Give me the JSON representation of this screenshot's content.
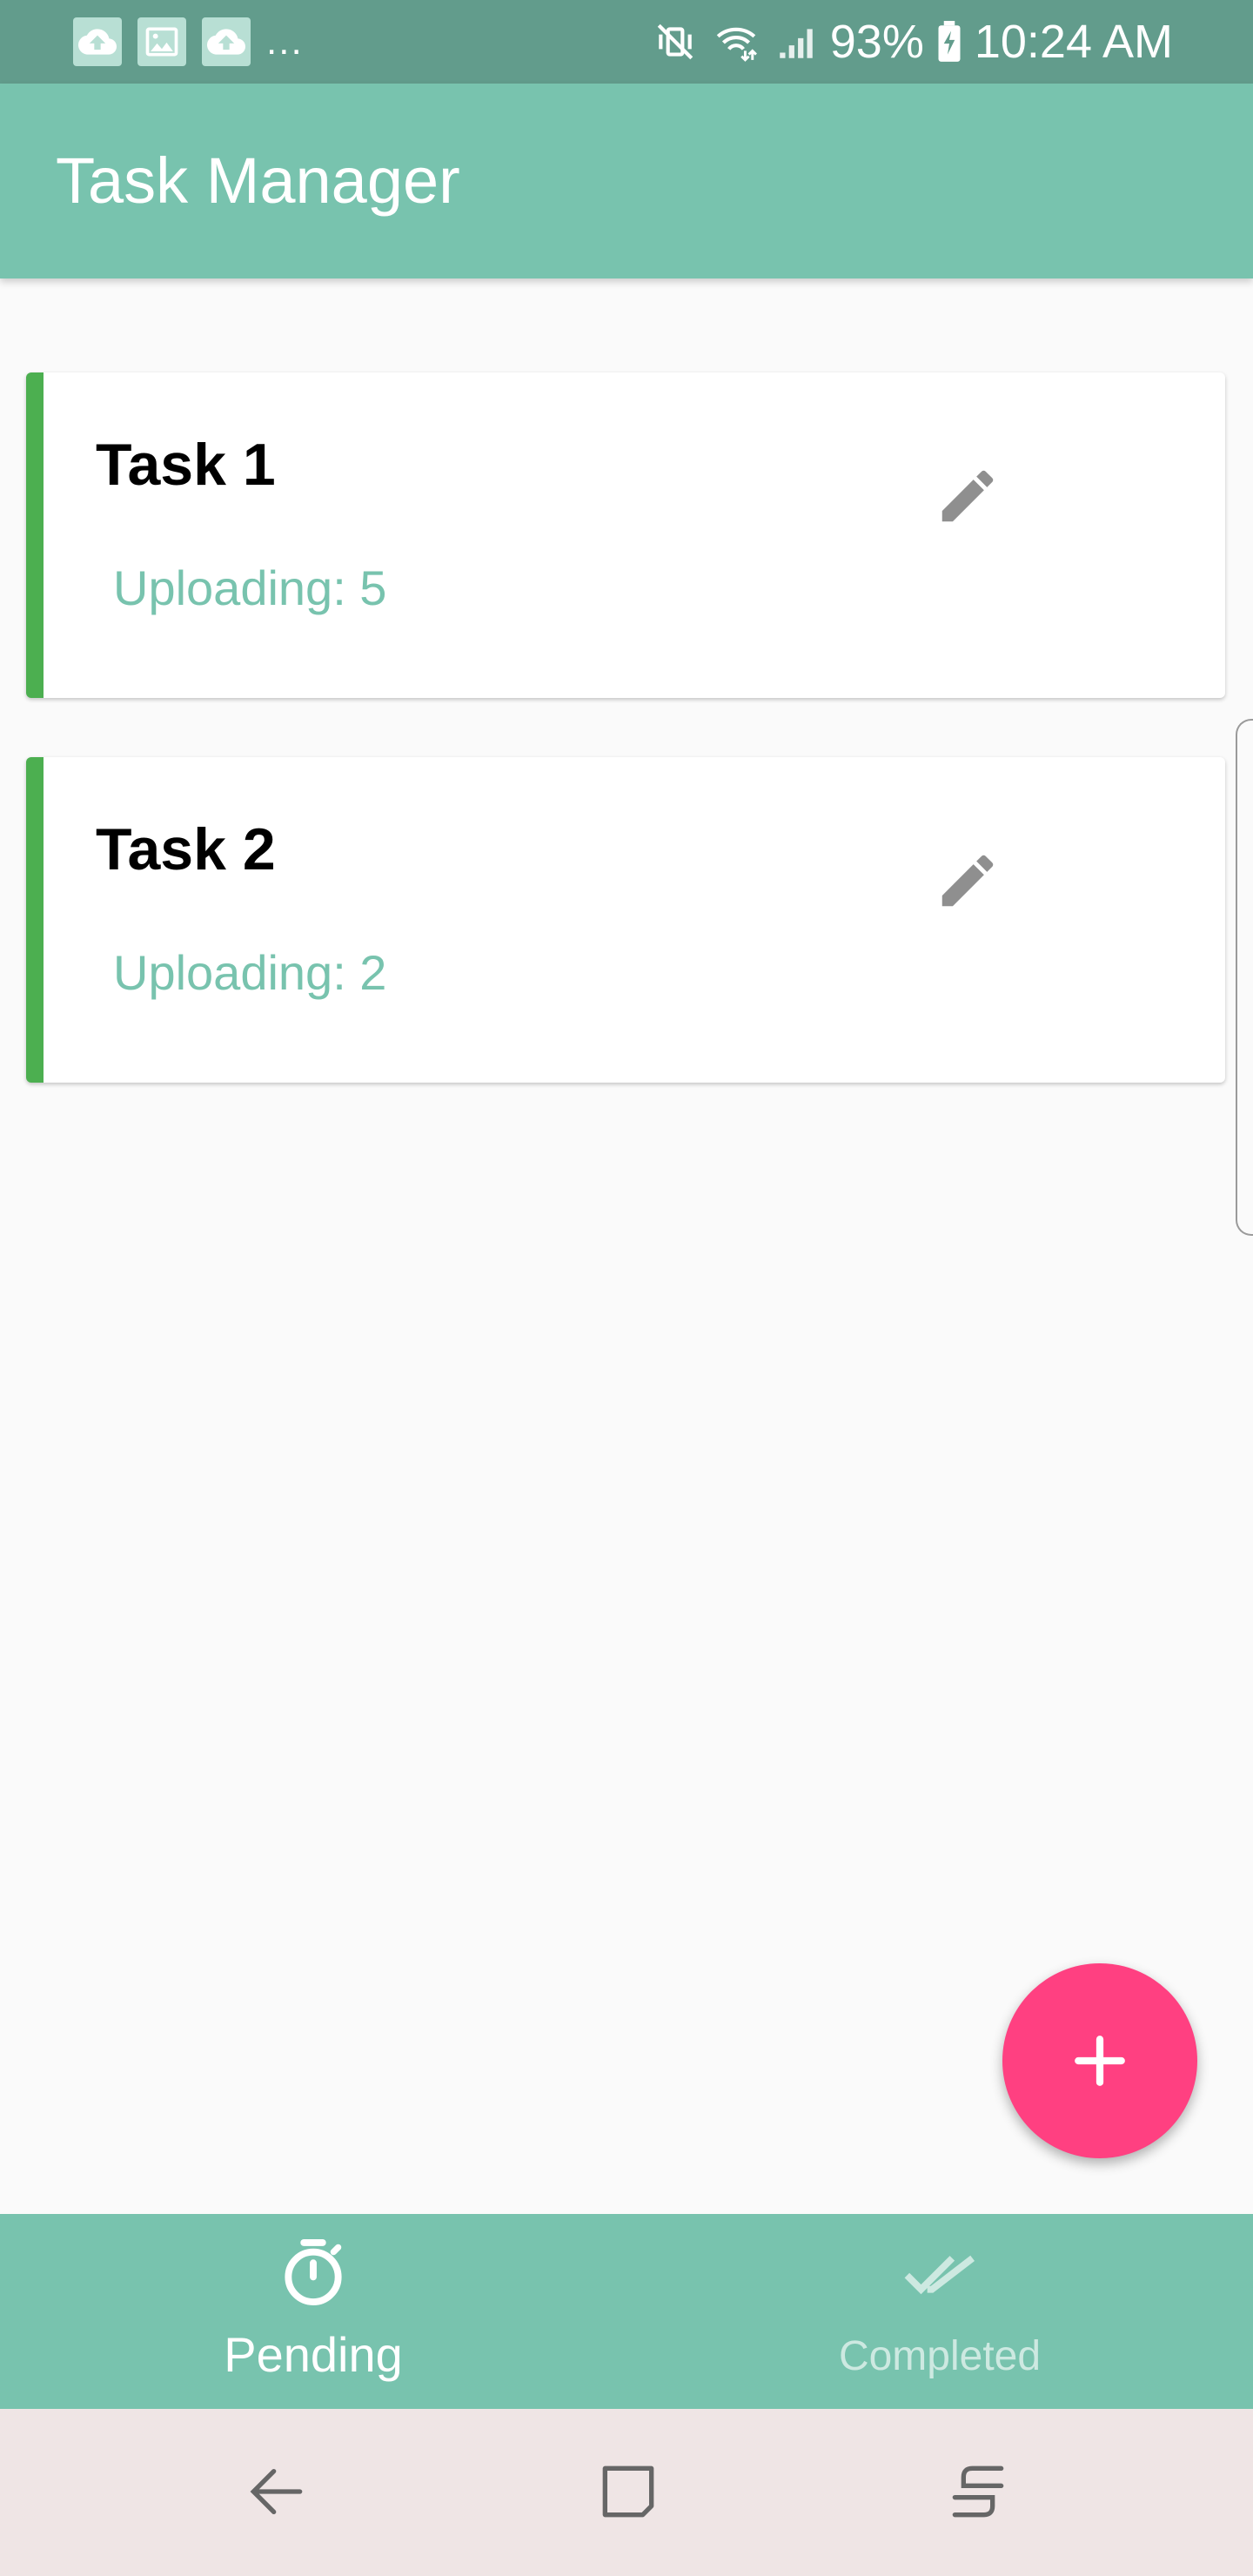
{
  "status_bar": {
    "notification_icons": [
      "cloud-upload-icon",
      "image-icon",
      "cloud-upload-icon"
    ],
    "overflow": "...",
    "battery": "93%",
    "time": "10:24 AM",
    "right_icons": [
      "vibrate-mute-icon",
      "wifi-icon",
      "signal-icon",
      "battery-charging-icon"
    ]
  },
  "app_bar": {
    "title": "Task Manager"
  },
  "tasks": [
    {
      "name": "Task 1",
      "status": "Uploading: 5",
      "edit_icon": "pencil-icon"
    },
    {
      "name": "Task 2",
      "status": "Uploading: 2",
      "edit_icon": "pencil-icon"
    }
  ],
  "fab": {
    "icon": "plus-icon"
  },
  "bottom_nav": {
    "items": [
      {
        "label": "Pending",
        "icon": "timer-icon",
        "active": true
      },
      {
        "label": "Completed",
        "icon": "double-check-icon",
        "active": false
      }
    ]
  },
  "system_nav": {
    "buttons": [
      "back-icon",
      "home-icon",
      "recents-icon"
    ]
  },
  "colors": {
    "status_bar": "#629c8c",
    "primary": "#78c3ae",
    "accent": "#ff4081",
    "card_stripe": "#4caf50",
    "system_nav": "#efe5e5"
  }
}
